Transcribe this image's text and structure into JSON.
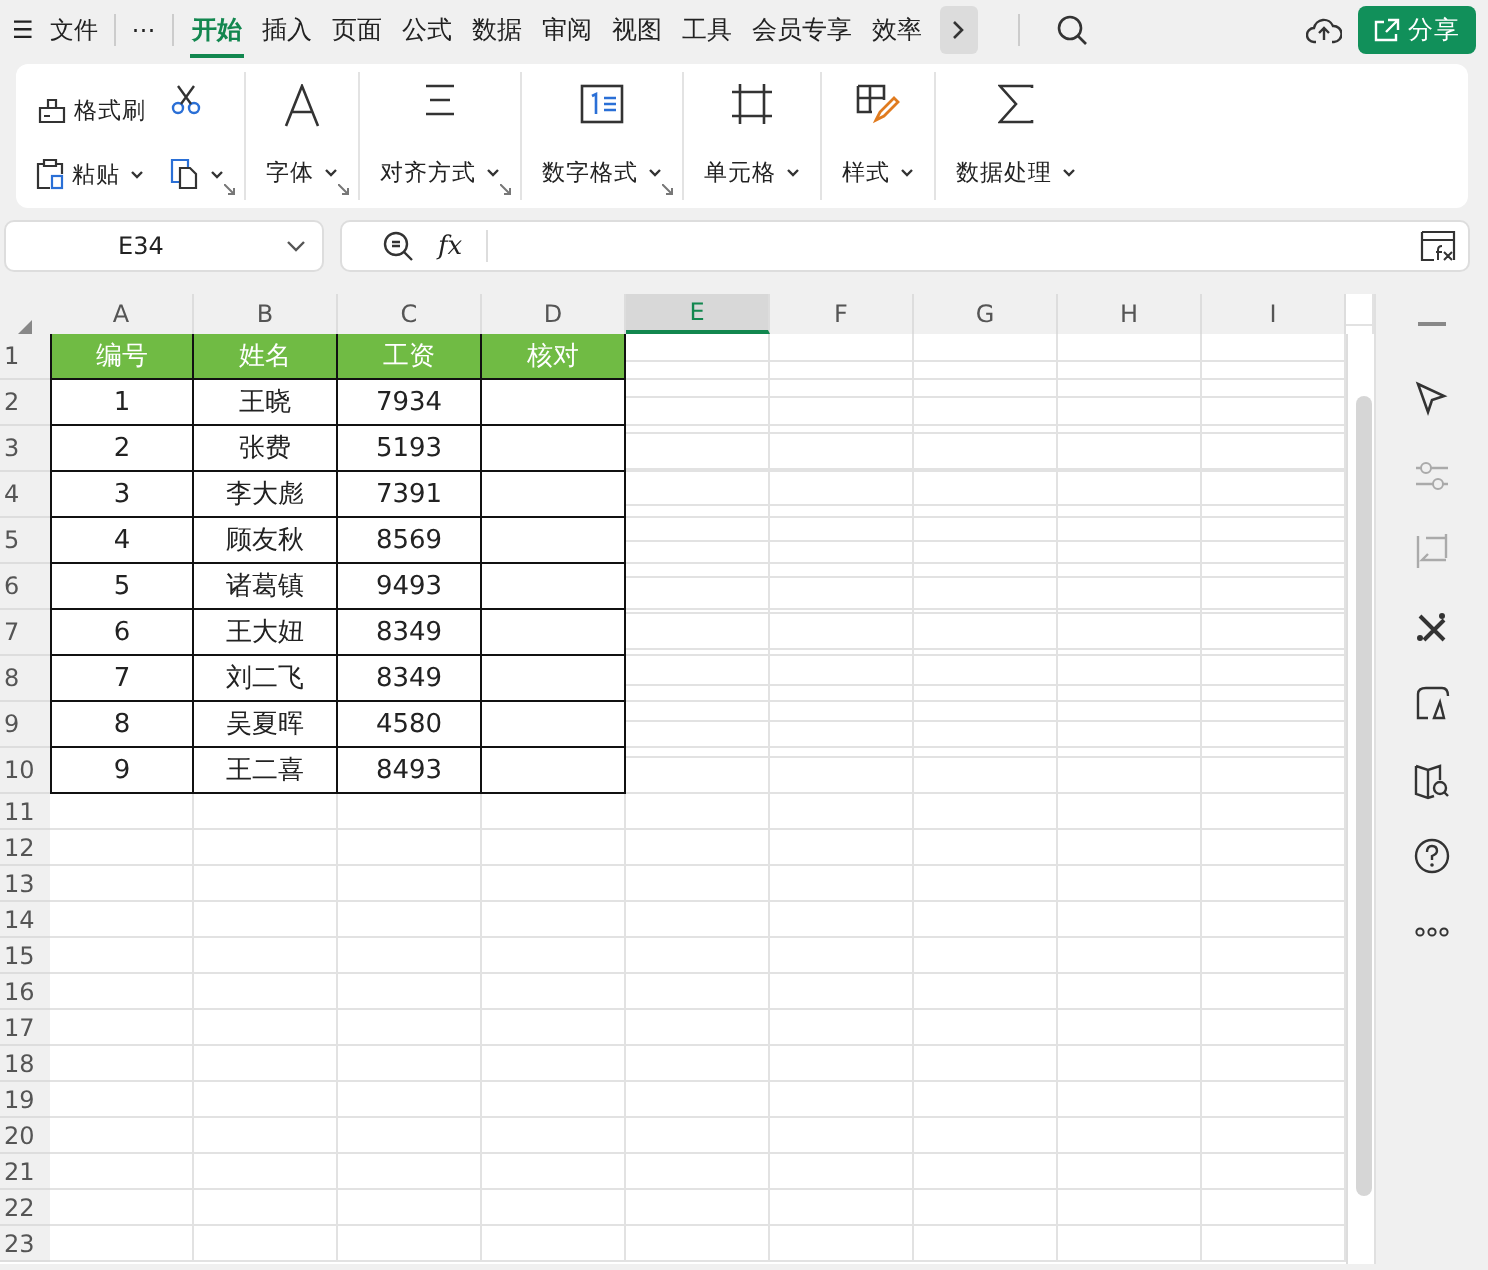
{
  "menu": {
    "hamburger": "☰",
    "file": "文件",
    "more": "⋯"
  },
  "tabs": [
    {
      "label": "开始",
      "selected": true
    },
    {
      "label": "插入",
      "selected": false
    },
    {
      "label": "页面",
      "selected": false
    },
    {
      "label": "公式",
      "selected": false
    },
    {
      "label": "数据",
      "selected": false
    },
    {
      "label": "审阅",
      "selected": false
    },
    {
      "label": "视图",
      "selected": false
    },
    {
      "label": "工具",
      "selected": false
    },
    {
      "label": "会员专享",
      "selected": false
    },
    {
      "label": "效率",
      "selected": false
    }
  ],
  "share": "分享",
  "ribbon": {
    "clipboard": {
      "format_painter": "格式刷",
      "paste": "粘贴"
    },
    "groups": [
      {
        "kind": "font",
        "label": "字体",
        "launcher": true
      },
      {
        "kind": "align",
        "label": "对齐方式",
        "launcher": true
      },
      {
        "kind": "number",
        "label": "数字格式",
        "launcher": true
      },
      {
        "kind": "cell",
        "label": "单元格",
        "launcher": false
      },
      {
        "kind": "style",
        "label": "样式",
        "launcher": false
      },
      {
        "kind": "sum",
        "label": "数据处理",
        "launcher": false
      }
    ]
  },
  "name_box": "E34",
  "formula_bar": {
    "fx": "fx"
  },
  "sheet": {
    "columns": [
      {
        "label": "A",
        "selected": false
      },
      {
        "label": "B",
        "selected": false
      },
      {
        "label": "C",
        "selected": false
      },
      {
        "label": "D",
        "selected": false
      },
      {
        "label": "E",
        "selected": true
      },
      {
        "label": "F",
        "selected": false
      },
      {
        "label": "G",
        "selected": false
      },
      {
        "label": "H",
        "selected": false
      },
      {
        "label": "I",
        "selected": false
      }
    ],
    "row_numbers": [
      "1",
      "2",
      "3",
      "4",
      "5",
      "6",
      "7",
      "8",
      "9",
      "10",
      "11",
      "12",
      "13",
      "14",
      "15",
      "16",
      "17",
      "18",
      "19",
      "20",
      "21",
      "22",
      "23"
    ],
    "table_header": [
      "编号",
      "姓名",
      "工资",
      "核对"
    ],
    "rows": [
      [
        "1",
        "王晓",
        "7934"
      ],
      [
        "2",
        "张费",
        "5193"
      ],
      [
        "3",
        "李大彪",
        "7391"
      ],
      [
        "4",
        "顾友秋",
        "8569"
      ],
      [
        "5",
        "诸葛镇",
        "9493"
      ],
      [
        "6",
        "王大妞",
        "8349"
      ],
      [
        "7",
        "刘二飞",
        "8349"
      ],
      [
        "8",
        "吴夏晖",
        "4580"
      ],
      [
        "9",
        "王二喜",
        "8493"
      ]
    ]
  }
}
